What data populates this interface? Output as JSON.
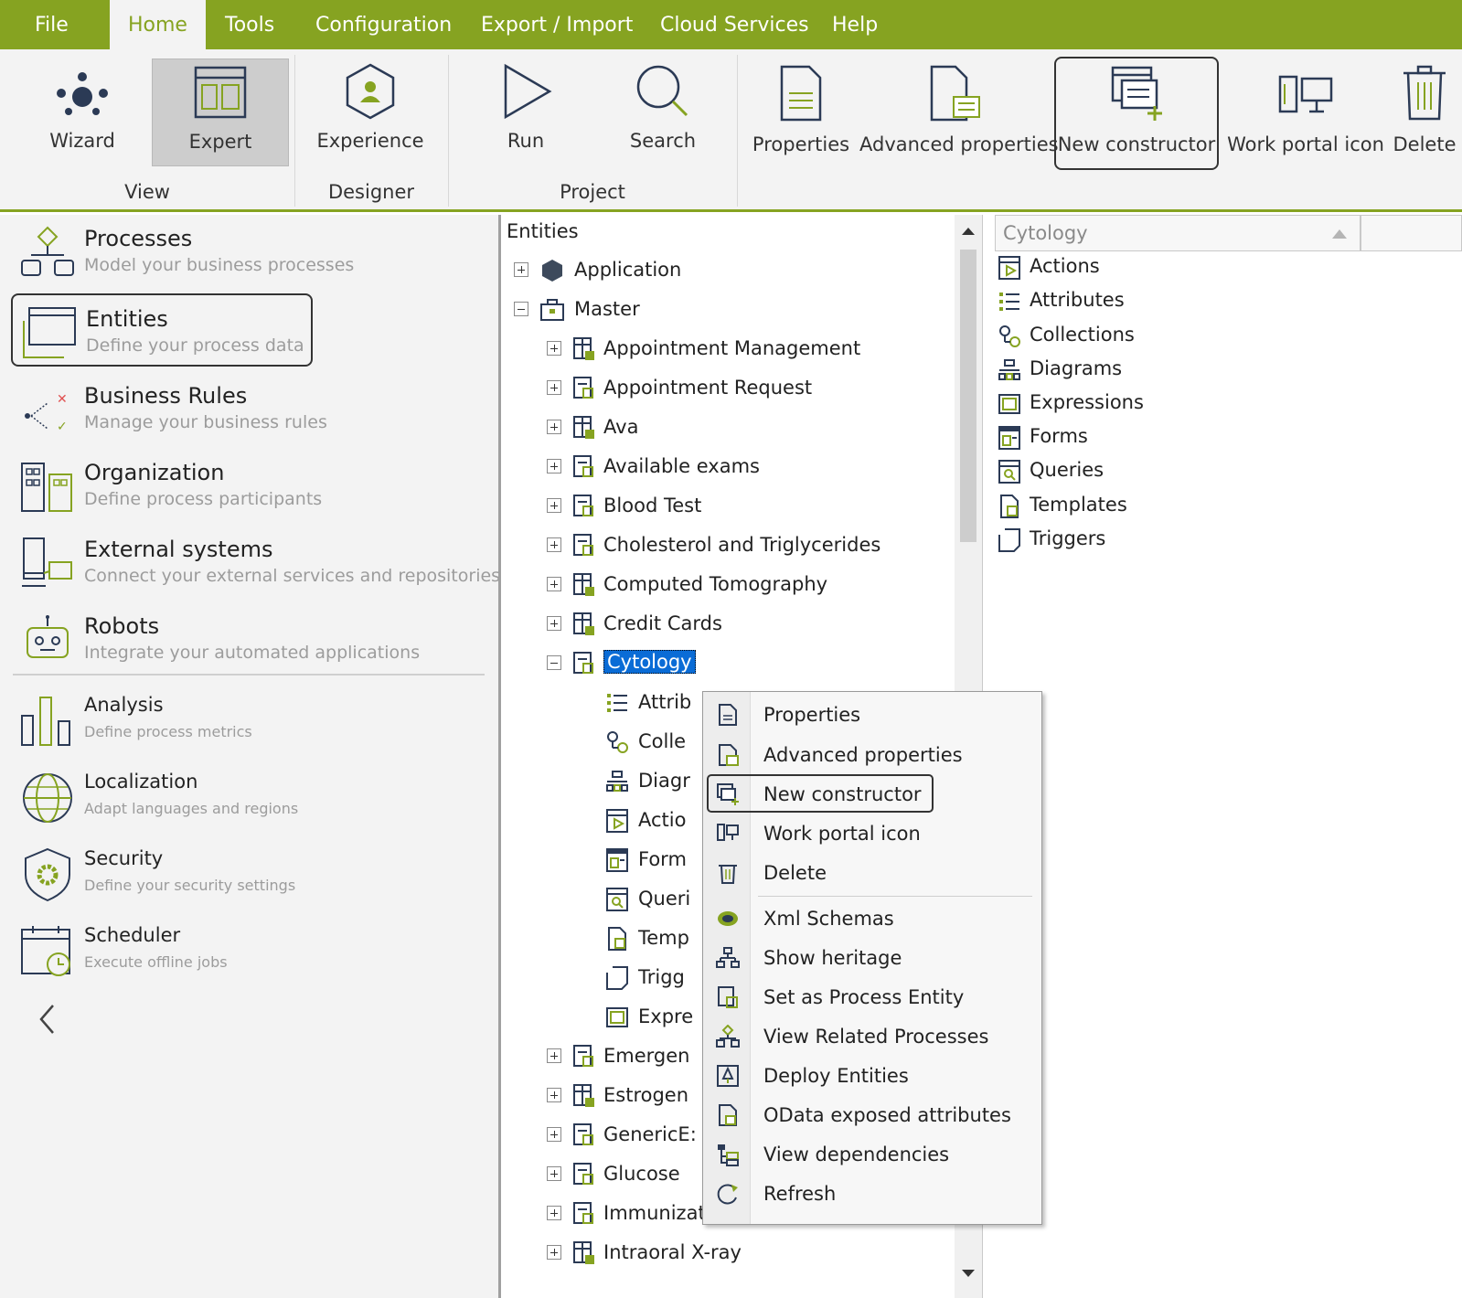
{
  "menubar": {
    "items": [
      {
        "label": "File",
        "active": false
      },
      {
        "label": "Home",
        "active": true
      },
      {
        "label": "Tools",
        "active": false
      },
      {
        "label": "Configuration",
        "active": false
      },
      {
        "label": "Export / Import",
        "active": false
      },
      {
        "label": "Cloud Services",
        "active": false
      },
      {
        "label": "Help",
        "active": false
      }
    ]
  },
  "ribbon": {
    "buttons": {
      "wizard": "Wizard",
      "expert": "Expert",
      "experience": "Experience",
      "run": "Run",
      "search": "Search",
      "properties": "Properties",
      "advanced_properties": "Advanced properties",
      "new_constructor": "New constructor",
      "work_portal_icon": "Work portal icon",
      "delete": "Delete"
    },
    "groups": {
      "view": "View",
      "designer": "Designer",
      "project": "Project"
    }
  },
  "leftnav": {
    "items": [
      {
        "title": "Processes",
        "subtitle": "Model your business processes"
      },
      {
        "title": "Entities",
        "subtitle": "Define your process data"
      },
      {
        "title": "Business Rules",
        "subtitle": "Manage your business rules"
      },
      {
        "title": "Organization",
        "subtitle": "Define process participants"
      },
      {
        "title": "External systems",
        "subtitle": "Connect your external services and repositories"
      },
      {
        "title": "Robots",
        "subtitle": "Integrate your automated applications"
      },
      {
        "title": "Analysis",
        "subtitle": "Define process metrics"
      },
      {
        "title": "Localization",
        "subtitle": "Adapt languages and regions"
      },
      {
        "title": "Security",
        "subtitle": "Define your security settings"
      },
      {
        "title": "Scheduler",
        "subtitle": "Execute offline jobs"
      }
    ]
  },
  "tree": {
    "header": "Entities",
    "nodes": [
      "Application",
      "Master",
      "Appointment Management",
      "Appointment Request",
      "Ava",
      "Available exams",
      "Blood Test",
      "Cholesterol and Triglycerides",
      "Computed Tomography",
      "Credit Cards",
      "Cytology",
      "Attrib",
      "Colle",
      "Diagr",
      "Actio",
      "Form",
      "Queri",
      "Temp",
      "Trigg",
      "Expre",
      "Emergen",
      "Estrogen",
      "GenericE:",
      "Glucose",
      "Immunization",
      "Intraoral X-ray"
    ]
  },
  "right_panel": {
    "header": "Cytology",
    "items": [
      "Actions",
      "Attributes",
      "Collections",
      "Diagrams",
      "Expressions",
      "Forms",
      "Queries",
      "Templates",
      "Triggers"
    ]
  },
  "context_menu": {
    "items": [
      "Properties",
      "Advanced properties",
      "New constructor",
      "Work portal icon",
      "Delete",
      "Xml Schemas",
      "Show heritage",
      "Set as Process Entity",
      "View Related Processes",
      "Deploy Entities",
      "OData exposed attributes",
      "View dependencies",
      "Refresh"
    ]
  },
  "colors": {
    "accent": "#86a321",
    "selection": "#0a6cd6"
  }
}
